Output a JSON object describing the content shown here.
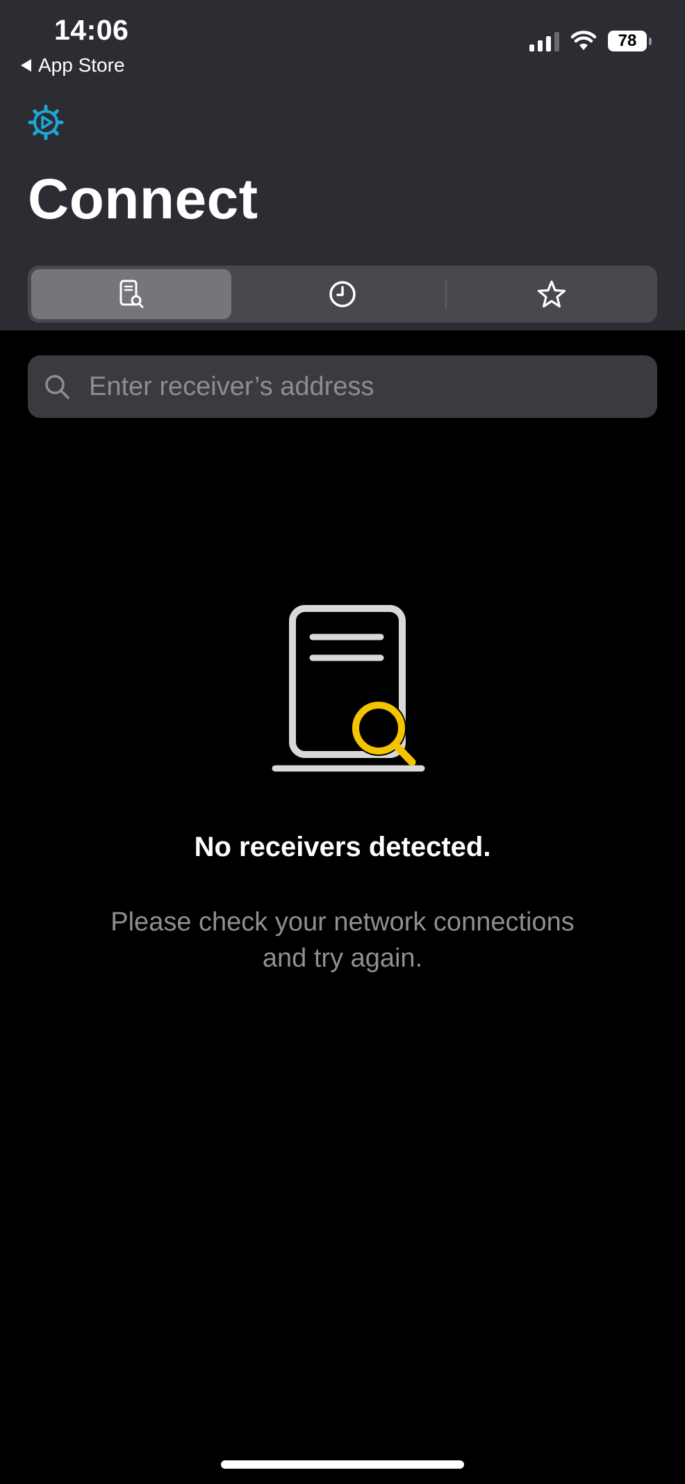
{
  "status_bar": {
    "time": "14:06",
    "back_label": "App Store",
    "battery": "78"
  },
  "header": {
    "title": "Connect",
    "settings_icon": "gear-play-icon",
    "accent_color": "#1ea7d6"
  },
  "tabs": [
    {
      "icon": "receiver-search-icon",
      "active": true
    },
    {
      "icon": "clock-icon",
      "active": false
    },
    {
      "icon": "star-icon",
      "active": false
    }
  ],
  "search": {
    "placeholder": "Enter receiver’s address",
    "value": ""
  },
  "empty_state": {
    "icon": "receiver-search-illustration",
    "title": "No receivers detected.",
    "subtitle_line1": "Please check your network connections",
    "subtitle_line2": "and try again.",
    "highlight_color": "#f5c400"
  }
}
